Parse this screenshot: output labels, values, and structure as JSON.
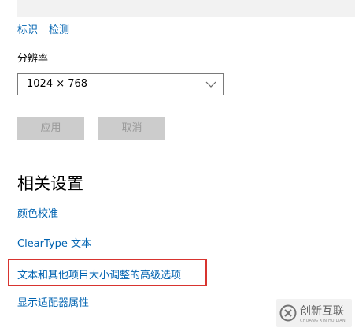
{
  "links": {
    "identify": "标识",
    "detect": "检测"
  },
  "resolution": {
    "label": "分辨率",
    "value": "1024 × 768"
  },
  "buttons": {
    "apply": "应用",
    "cancel": "取消"
  },
  "related": {
    "title": "相关设置",
    "items": [
      {
        "label": "颜色校准"
      },
      {
        "label": "ClearType 文本"
      },
      {
        "label": "文本和其他项目大小调整的高级选项"
      },
      {
        "label": "显示适配器属性"
      }
    ]
  },
  "watermark": {
    "text": "创新互联",
    "subtext": "CHUANG XIN HU LIAN"
  },
  "colors": {
    "link": "#0063b1",
    "highlight": "#d8342f",
    "button_bg": "#cccccc",
    "button_text": "#9b9b9b"
  }
}
